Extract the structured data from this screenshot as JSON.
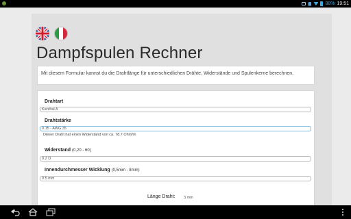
{
  "status_bar": {
    "battery": "88%",
    "time": "19:51",
    "icons": [
      "app-icon",
      "usb-icon",
      "sd-card-icon",
      "wifi-icon",
      "battery-icon"
    ]
  },
  "languages": [
    {
      "name": "english-flag-icon",
      "code": "en"
    },
    {
      "name": "italian-flag-icon",
      "code": "it"
    }
  ],
  "page": {
    "title": "Dampfspulen Rechner",
    "intro": "Mit diesem Formular kannst du die Drahtlänge für unterschiedlichen Drähte, Widerstände und Spulenkerne berechnen."
  },
  "form": {
    "wire_type": {
      "label": "Drahtart",
      "value": "Kanthal A"
    },
    "wire_gauge": {
      "label": "Drahtstärke",
      "value": "0.15 - AWG 35",
      "note": "Dieser Draht hat einen Widerstand von ca. 78.7 Ohm/m"
    },
    "resistance": {
      "label": "Widerstand",
      "hint": "(0,20 - 60)",
      "value": "0.2 Ω"
    },
    "inner_diameter": {
      "label": "Innendurchmesser Wicklung",
      "hint": "(0,5mm - 8mm)",
      "value": "0.5 mm"
    },
    "result": {
      "label": "Länge Draht:",
      "value": "3 mm"
    }
  },
  "nav_bar": {
    "icons": [
      "back-icon",
      "home-icon",
      "recent-apps-icon",
      "overflow-menu-icon"
    ]
  },
  "colors": {
    "status_accent": "#39a9e0",
    "panel": "#e0e0e0",
    "background": "#ebebeb",
    "focused_border": "#7ab7e0"
  }
}
